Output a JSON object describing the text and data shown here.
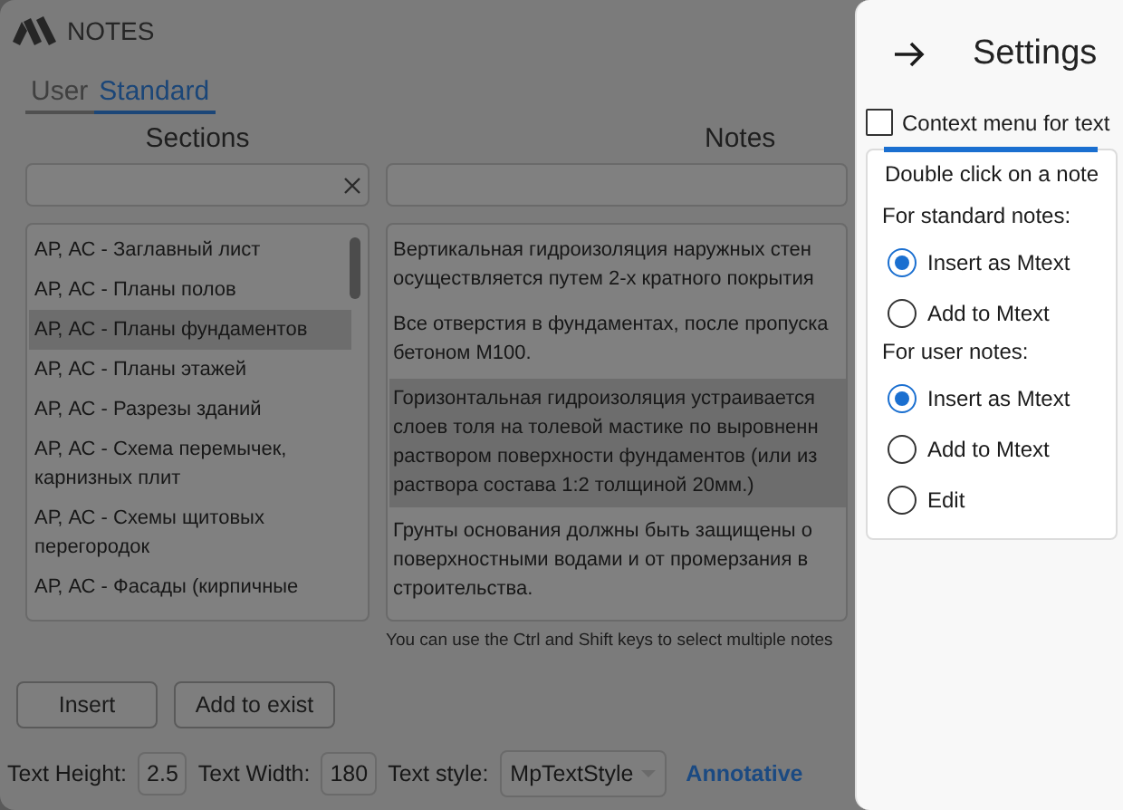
{
  "window": {
    "title": "NOTES"
  },
  "tabs": [
    {
      "label": "User",
      "selected": false
    },
    {
      "label": "Standard",
      "selected": true
    }
  ],
  "sections": {
    "heading": "Sections",
    "items": [
      {
        "label": "АР, АС - Заглавный лист",
        "selected": false
      },
      {
        "label": "АР, АС - Планы полов",
        "selected": false
      },
      {
        "label": "АР, АС - Планы фундаментов",
        "selected": true
      },
      {
        "label": "АР, АС - Планы этажей",
        "selected": false
      },
      {
        "label": "АР, АС - Разрезы зданий",
        "selected": false
      },
      {
        "label": "АР, АС - Схема перемычек, карнизных плит",
        "selected": false
      },
      {
        "label": "АР, АС - Схемы щитовых перегородок",
        "selected": false
      },
      {
        "label": "АР, АС - Фасады (кирпичные",
        "selected": false
      }
    ]
  },
  "notes": {
    "heading": "Notes",
    "items": [
      {
        "lines": [
          "Вертикальная гидроизоляция наружных стен",
          "осуществляется путем 2-х кратного покрытия"
        ],
        "selected": false
      },
      {
        "lines": [
          "Все отверстия в фундаментах, после пропуска",
          "бетоном М100."
        ],
        "selected": false
      },
      {
        "lines": [
          "Горизонтальная гидроизоляция устраивается",
          "слоев толя на толевой мастике по выровненн",
          "раствором поверхности фундаментов (или из",
          "раствора состава 1:2 толщиной 20мм.)"
        ],
        "selected": true
      },
      {
        "lines": [
          "Грунты основания должны быть защищены о",
          "поверхностными водами и от промерзания в",
          "строительства."
        ],
        "selected": false
      }
    ],
    "hint": "You can use the Ctrl and Shift keys to select multiple notes"
  },
  "buttons": [
    "Insert",
    "Add to exist"
  ],
  "status_bar": {
    "fields": [
      {
        "label": "Text Height:",
        "value": "2.5"
      },
      {
        "label": "Text Width:",
        "value": "180"
      }
    ],
    "style": {
      "label": "Text style:",
      "value": "MpTextStyle"
    },
    "link": "Annotative"
  },
  "settings": {
    "title": "Settings",
    "context_menu": {
      "label": "Context menu for text",
      "checked": false
    },
    "double_click": {
      "title": "Double click on a note",
      "groups": [
        {
          "label": "For standard notes:",
          "options": [
            {
              "label": "Insert as Mtext",
              "selected": true
            },
            {
              "label": "Add to Mtext",
              "selected": false
            }
          ]
        },
        {
          "label": "For user notes:",
          "options": [
            {
              "label": "Insert as Mtext",
              "selected": true
            },
            {
              "label": "Add to Mtext",
              "selected": false
            },
            {
              "label": "Edit",
              "selected": false
            }
          ]
        }
      ]
    }
  }
}
